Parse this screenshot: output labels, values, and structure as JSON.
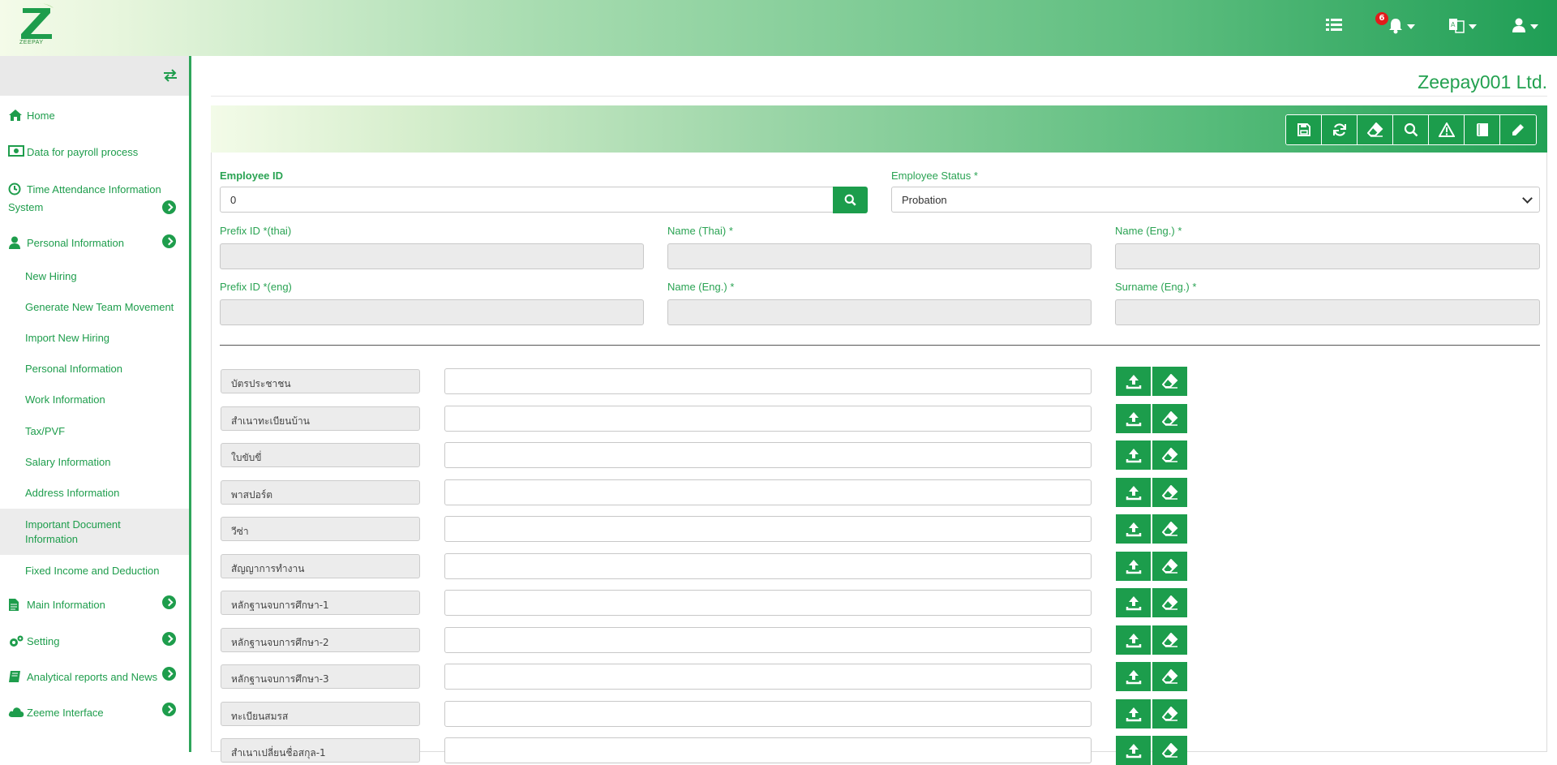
{
  "brand": {
    "logo_text": "ZEEPAY",
    "accent": "#1e9d4c"
  },
  "topbar": {
    "notifications_count": "6",
    "icons": [
      "list-icon",
      "bell-icon",
      "translate-icon",
      "user-icon"
    ]
  },
  "sidebar": {
    "items": [
      {
        "label": "Home",
        "icon": "home-icon"
      },
      {
        "label": "Data for payroll process",
        "icon": "money-icon"
      },
      {
        "label_1": "Time Attendance Information",
        "label_2": "System",
        "icon": "clock-icon"
      },
      {
        "label": "Personal Information",
        "icon": "person-icon"
      },
      {
        "label": "Main Information",
        "icon": "document-icon"
      },
      {
        "label": "Setting",
        "icon": "gears-icon"
      },
      {
        "label": "Analytical reports and News",
        "icon": "book-icon"
      },
      {
        "label": "Zeeme Interface",
        "icon": "cloud-icon"
      }
    ],
    "sub_items": [
      "New Hiring",
      "Generate New Team Movement",
      "Import New Hiring",
      "Personal Information",
      "Work Information",
      "Tax/PVF",
      "Salary Information",
      "Address Information",
      "Important Document",
      "Information",
      "Fixed Income and Deduction"
    ]
  },
  "main": {
    "company": "Zeepay001 Ltd.",
    "toolbar": [
      "save-icon",
      "refresh-icon",
      "eraser-icon",
      "search-icon",
      "warning-icon",
      "book-icon",
      "pencil-icon"
    ],
    "form": {
      "employee_id_label": "Employee ID",
      "employee_id_value": "0",
      "employee_status_label": "Employee Status",
      "employee_status_value": "Probation",
      "prefix_thai_label": "Prefix ID",
      "prefix_thai_suffix": "(thai)",
      "name_thai_label": "Name (Thai)",
      "name_eng_label": "Name (Eng.)",
      "prefix_eng_label": "Prefix ID",
      "prefix_eng_suffix": "(eng)",
      "name_eng2_label": "Name (Eng.)",
      "surname_eng_label": "Surname (Eng.)",
      "required_mark": "*"
    },
    "documents": [
      "บัตรประชาชน",
      "สำเนาทะเบียนบ้าน",
      "ใบขับขี่",
      "พาสปอร์ต",
      "วีซ่า",
      "สัญญาการทำงาน",
      "หลักฐานจบการศึกษา-1",
      "หลักฐานจบการศึกษา-2",
      "หลักฐานจบการศึกษา-3",
      "ทะเบียนสมรส",
      "สำเนาเปลี่ยนชื่อสกุล-1"
    ]
  }
}
